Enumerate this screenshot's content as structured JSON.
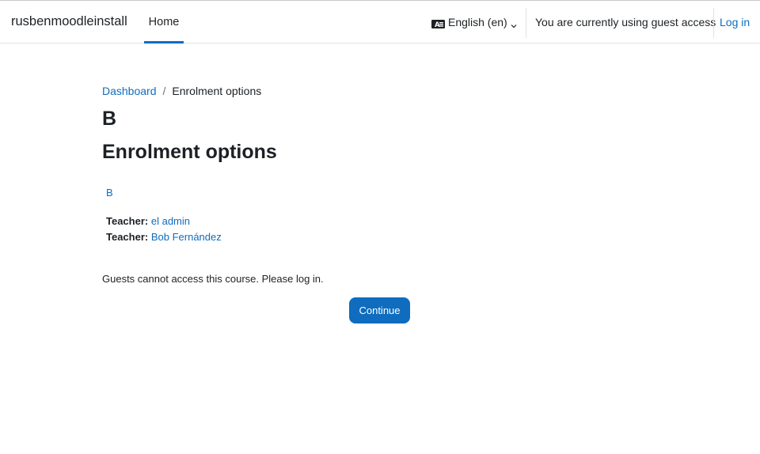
{
  "navbar": {
    "brand": "rusbenmoodleinstall",
    "home_label": "Home",
    "language_label": "English (en)",
    "guest_message": "You are currently using guest access",
    "login_label": "Log in",
    "accent_color": "#0f6cbf"
  },
  "breadcrumb": {
    "dashboard": "Dashboard",
    "separator": "/",
    "current": "Enrolment options"
  },
  "course": {
    "title": "B",
    "heading": "Enrolment options",
    "link_label": "B",
    "teachers": [
      {
        "role": "Teacher:",
        "name": "el admin"
      },
      {
        "role": "Teacher:",
        "name": "Bob Fernández"
      }
    ]
  },
  "notice": "Guests cannot access this course. Please log in.",
  "continue_label": "Continue",
  "icons": {
    "language": "language-icon",
    "dropdown": "chevron-down-icon"
  }
}
